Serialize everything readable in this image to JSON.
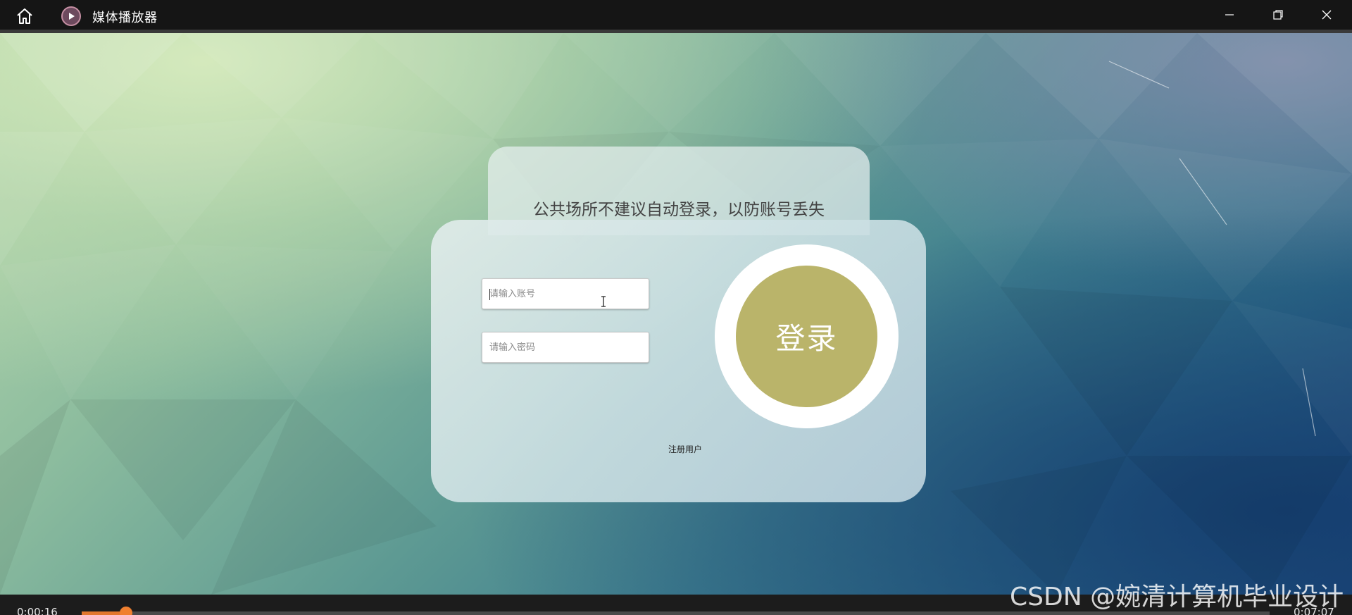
{
  "window": {
    "title": "媒体播放器",
    "icons": {
      "home": "home-icon",
      "app": "play-circle-icon",
      "minimize": "minimize-icon",
      "maximize": "restore-icon",
      "close": "close-icon"
    }
  },
  "login": {
    "notice": "公共场所不建议自动登录，以防账号丢失",
    "account_placeholder": "请输入账号",
    "password_placeholder": "请输入密码",
    "login_label": "登录",
    "register_label": "注册用户",
    "login_color": "#bab46a"
  },
  "player": {
    "current_time": "0:00:16",
    "total_time": "0:07:07",
    "progress_fraction": 0.0375,
    "accent_color": "#e2772d"
  },
  "watermark": "CSDN @婉清计算机毕业设计"
}
